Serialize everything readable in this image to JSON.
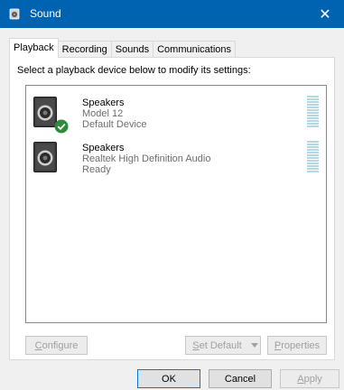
{
  "window": {
    "title": "Sound",
    "close_glyph": "✕"
  },
  "tabs": [
    {
      "label": "Playback",
      "active": true
    },
    {
      "label": "Recording",
      "active": false
    },
    {
      "label": "Sounds",
      "active": false
    },
    {
      "label": "Communications",
      "active": false
    }
  ],
  "instruction": "Select a playback device below to modify its settings:",
  "devices": [
    {
      "name": "Speakers",
      "model": "Model 12",
      "status": "Default Device",
      "is_default": true
    },
    {
      "name": "Speakers",
      "model": "Realtek High Definition Audio",
      "status": "Ready",
      "is_default": false
    }
  ],
  "buttons": {
    "configure": {
      "accel": "C",
      "rest": "onfigure"
    },
    "set_default": {
      "accel": "S",
      "rest": "et Default"
    },
    "properties": {
      "accel": "P",
      "rest": "roperties"
    },
    "ok": "OK",
    "cancel": "Cancel",
    "apply": {
      "accel": "A",
      "rest": "pply"
    }
  },
  "colors": {
    "titlebar": "#0063b1",
    "default_check": "#2e8b3a",
    "meter_idle": "#b6d7e3"
  },
  "icons": {
    "app": "speaker-icon",
    "default": "check-badge-icon",
    "dropdown": "caret-down-icon"
  }
}
